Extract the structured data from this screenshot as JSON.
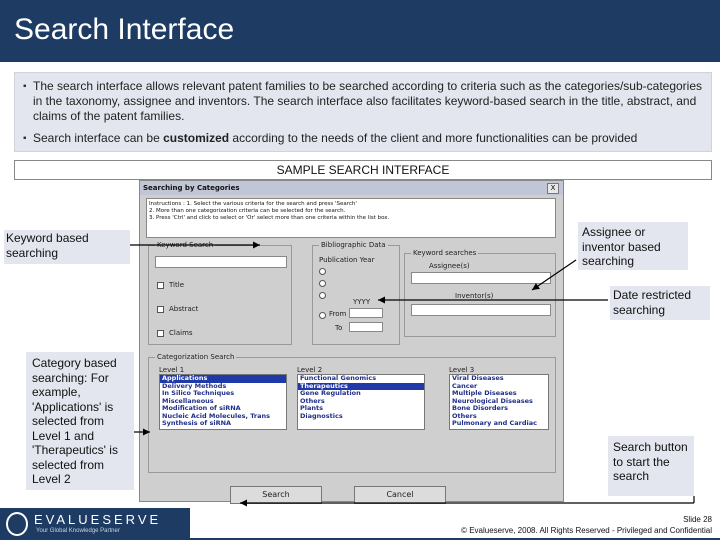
{
  "slide": {
    "title": "Search Interface",
    "bullets": [
      {
        "text": "The search interface allows relevant patent families to be searched according to criteria such as the categories/sub-categories in the taxonomy, assignee and inventors. The search interface also facilitates keyword-based search in the title, abstract, and claims of the patent families."
      },
      {
        "pre": "Search interface can be ",
        "bold": "customized",
        "post": " according to the needs of the client and more functionalities can be provided"
      }
    ],
    "sample_title": "SAMPLE SEARCH INTERFACE"
  },
  "dialog": {
    "title": "Searching by Categories",
    "close": "X",
    "instructions": [
      "Instructions : 1. Select the various criteria for the search and press 'Search'",
      "2. More than one categorization criteria can be selected for the search.",
      "3. Press 'Ctrl' and click to select or 'Or' select more than one criteria within the list box."
    ],
    "keyword_search": {
      "label": "Keyword Search",
      "options": [
        "Title",
        "Abstract",
        "Claims"
      ]
    },
    "bibliographic": {
      "label": "Bibliographic Data",
      "pub_year": "Publication Year",
      "yyyy": "YYYY",
      "from": "From",
      "to": "To"
    },
    "keyword_searches": {
      "label": "Keyword searches",
      "assignee": "Assignee(s)",
      "inventor": "Inventor(s)"
    },
    "categorization": {
      "label": "Categorization Search",
      "level1": {
        "label": "Level 1",
        "items": [
          "Applications",
          "Delivery Methods",
          "In Silico Techniques",
          "Miscellaneous",
          "Modification of siRNA",
          "Nucleic Acid Molecules, Trans",
          "Synthesis of siRNA"
        ],
        "selected": 0
      },
      "level2": {
        "label": "Level 2",
        "items": [
          "Functional Genomics",
          "Therapeutics",
          "Gene Regulation",
          "Others",
          "Plants",
          "Diagnostics"
        ],
        "selected": 1
      },
      "level3": {
        "label": "Level 3",
        "items": [
          "Viral Diseases",
          "Cancer",
          "Multiple Diseases",
          "Neurological Diseases",
          "Bone Disorders",
          "Others",
          "Pulmonary and Cardiac"
        ],
        "selected": -1
      }
    },
    "buttons": {
      "search": "Search",
      "cancel": "Cancel"
    }
  },
  "callouts": {
    "keyword": "Keyword based searching",
    "assignee": "Assignee or inventor based searching",
    "date": "Date restricted searching",
    "category_pre": "Category based searching",
    "category_post": ": For example, 'Applications' is selected from Level 1 and 'Therapeutics' is selected from Level 2",
    "search_button": "Search button to start the search"
  },
  "footer": {
    "logo": "EVALUESERVE",
    "tagline": "Your Global Knowledge Partner",
    "slide_no": "Slide 28",
    "copyright": "© Evalueserve, 2008. All Rights Reserved - Privileged and Confidential"
  },
  "colors": {
    "brand": "#1d3b63",
    "panel": "#e3e6ee",
    "select": "#1f3aa8"
  }
}
